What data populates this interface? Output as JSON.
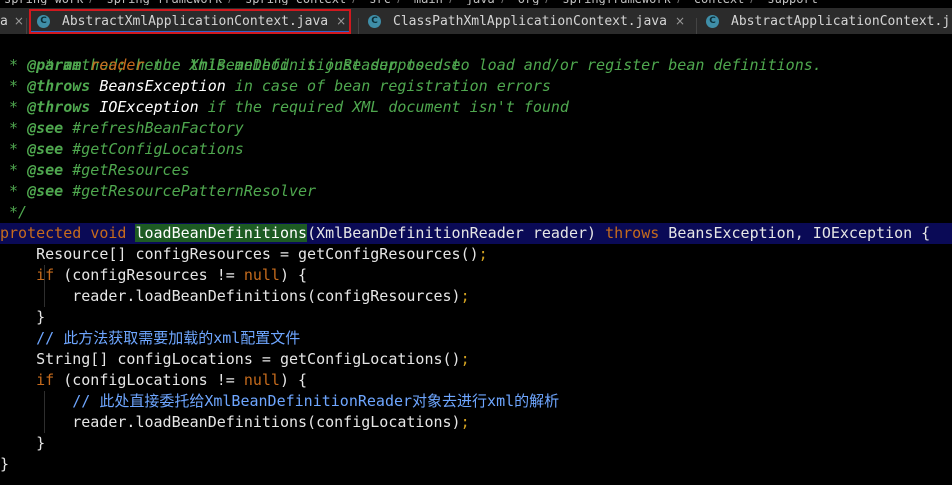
{
  "breadcrumb": [
    "spring-work",
    "spring-framework",
    "spring-context",
    "src",
    "main",
    "java",
    "org",
    "springframework",
    "context",
    "support"
  ],
  "tabs": {
    "partial_left": "a",
    "active": "AbstractXmlApplicationContext.java",
    "tab2": "ClassPathXmlApplicationContext.java",
    "tab3": "AbstractApplicationContext.j",
    "close_glyph": "×",
    "file_icon_glyph": "C"
  },
  "code": {
    "doc1": " * method; hence this method is just supposed to load and/or register bean definitions.",
    "doc2_tag": "@param",
    "doc2_ref": "reader",
    "doc2_rest": " the XmlBeanDefinitionReader to use",
    "doc3_tag": "@throws",
    "doc3_ref": "BeansException",
    "doc3_rest": " in case of bean registration errors",
    "doc4_tag": "@throws",
    "doc4_ref": "IOException",
    "doc4_rest": " if the required XML document isn't found",
    "see_tag": "@see",
    "see1": " #refreshBeanFactory",
    "see2": " #getConfigLocations",
    "see3": " #getResources",
    "see4": " #getResourcePatternResolver",
    "doc_end": " */",
    "sig_protected": "protected",
    "sig_void": "void",
    "sig_method": "loadBeanDefinitions",
    "sig_params": "(XmlBeanDefinitionReader reader) ",
    "sig_throws": "throws",
    "sig_rest": " BeansException, IOException {",
    "l1": "    Resource[] configResources = getConfigResources()",
    "if_kw": "if",
    "l2a": " (configResources != ",
    "null_kw": "null",
    "l2b": ") {",
    "l3": "        reader.loadBeanDefinitions(configResources)",
    "close_brace": "}",
    "comment1": "    // 此方法获取需要加载的xml配置文件",
    "l5": "    String[] configLocations = getConfigLocations()",
    "l6a": " (configLocations != ",
    "comment2": "        // 此处直接委托给XmlBeanDefinitionReader对象去进行xml的解析",
    "l7": "        reader.loadBeanDefinitions(configLocations)",
    "semi": ";"
  }
}
